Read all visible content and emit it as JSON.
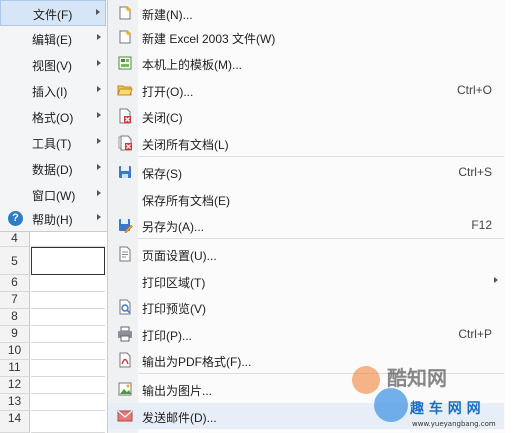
{
  "main_menu": {
    "items": [
      {
        "label": "文件(F)"
      },
      {
        "label": "编辑(E)"
      },
      {
        "label": "视图(V)"
      },
      {
        "label": "插入(I)"
      },
      {
        "label": "格式(O)"
      },
      {
        "label": "工具(T)"
      },
      {
        "label": "数据(D)"
      },
      {
        "label": "窗口(W)"
      },
      {
        "label": "帮助(H)"
      }
    ]
  },
  "submenu": {
    "items": [
      {
        "label": "新建(N)...",
        "shortcut": "",
        "icon": "new-document-icon"
      },
      {
        "label": "新建 Excel 2003 文件(W)",
        "shortcut": "",
        "icon": "new-excel-icon"
      },
      {
        "label": "本机上的模板(M)...",
        "shortcut": "",
        "icon": "template-icon"
      },
      {
        "label": "打开(O)...",
        "shortcut": "Ctrl+O",
        "icon": "open-folder-icon"
      },
      {
        "label": "关闭(C)",
        "shortcut": "",
        "icon": "close-document-icon"
      },
      {
        "label": "关闭所有文档(L)",
        "shortcut": "",
        "icon": "close-all-icon"
      },
      {
        "label": "保存(S)",
        "shortcut": "Ctrl+S",
        "icon": "save-icon"
      },
      {
        "label": "保存所有文档(E)",
        "shortcut": "",
        "icon": ""
      },
      {
        "label": "另存为(A)...",
        "shortcut": "F12",
        "icon": "save-as-icon"
      },
      {
        "label": "页面设置(U)...",
        "shortcut": "",
        "icon": "page-setup-icon"
      },
      {
        "label": "打印区域(T)",
        "shortcut": "",
        "icon": ""
      },
      {
        "label": "打印预览(V)",
        "shortcut": "",
        "icon": "print-preview-icon"
      },
      {
        "label": "打印(P)...",
        "shortcut": "Ctrl+P",
        "icon": "printer-icon"
      },
      {
        "label": "输出为PDF格式(F)...",
        "shortcut": "",
        "icon": "pdf-icon"
      },
      {
        "label": "输出为图片...",
        "shortcut": "",
        "icon": "image-export-icon"
      },
      {
        "label": "发送邮件(D)...",
        "shortcut": "",
        "icon": "mail-icon"
      }
    ]
  },
  "grid": {
    "row_numbers": [
      "4",
      "5",
      "6",
      "7",
      "8",
      "9",
      "10",
      "11",
      "12",
      "13",
      "14"
    ]
  },
  "watermark": {
    "line1": "酷知网",
    "line2": "趣 车 网 网",
    "url": "www.yueyangbang.com"
  }
}
